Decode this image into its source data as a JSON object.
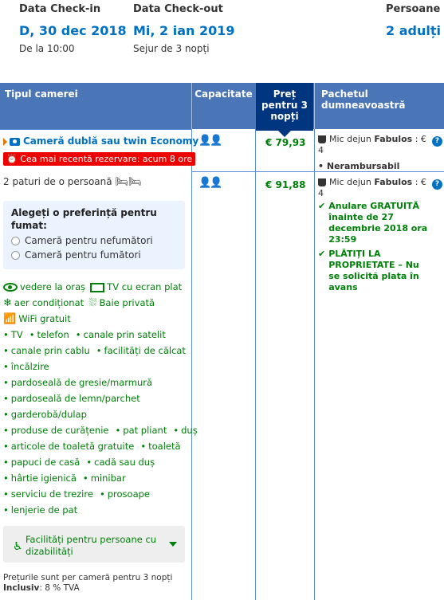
{
  "summary": {
    "checkin_label": "Data Check-in",
    "checkin_value": "D, 30 dec 2018",
    "checkin_sub": "De la 10:00",
    "checkout_label": "Data Check-out",
    "checkout_value": "Mi, 2 ian 2019",
    "checkout_sub": "Sejur de 3 nopți",
    "guests_label": "Persoane",
    "guests_value": "2 adulți"
  },
  "table_header": {
    "type": "Tipul camerei",
    "capacity": "Capacitate",
    "price": "Preț pentru 3 nopți",
    "package": "Pachetul dumneavoastră"
  },
  "room": {
    "title": "Cameră dublă sau twin Economy",
    "badge": "Cea mai recentă rezervare: acum 8 ore",
    "beds": "2 paturi de o persoană",
    "smoking_title": "Alegeți o preferință pentru fumat:",
    "smoking_options": [
      "Cameră pentru nefumători",
      "Cameră pentru fumători"
    ],
    "facilities_top": [
      "vedere la oraș",
      "TV cu ecran plat",
      "aer condiționat",
      "Baie privată",
      "WiFi gratuit"
    ],
    "facilities": [
      [
        "TV",
        "telefon",
        "canale prin satelit"
      ],
      [
        "canale prin cablu",
        "facilități de călcat"
      ],
      [
        "încălzire"
      ],
      [
        "pardoseală de gresie/marmură"
      ],
      [
        "pardoseală de lemn/parchet"
      ],
      [
        "garderobă/dulap"
      ],
      [
        "produse de curățenie",
        "pat pliant",
        "duș"
      ],
      [
        "articole de toaletă gratuite",
        "toaletă"
      ],
      [
        "papuci de casă",
        "cadă sau duș"
      ],
      [
        "hârtie igienică",
        "minibar"
      ],
      [
        "serviciu de trezire",
        "prosoape"
      ],
      [
        "lenjerie de pat"
      ]
    ],
    "accessibility": "Facilități pentru persoane cu dizabilități",
    "footnote_line1": "Prețurile sunt per cameră pentru 3 nopți",
    "footnote_bold": "Inclusiv",
    "footnote_rest": ": 8 % TVA"
  },
  "offers": [
    {
      "price": "€ 79,93",
      "meal_prefix": "Mic dejun ",
      "meal_bold": "Fabulos",
      "meal_price": " : € 4",
      "conditions": [
        "Nerambursabil"
      ]
    },
    {
      "price": "€ 91,88",
      "meal_prefix": "Mic dejun ",
      "meal_bold": "Fabulos",
      "meal_price": " : € 4",
      "green_conditions": [
        "Anulare GRATUITĂ înainte de 27 decembrie 2018 ora 23:59",
        "PLĂTIȚI LA PROPRIETATE – Nu se solicită plata în avans"
      ]
    }
  ],
  "colors": {
    "header_bg": "#4a75b6",
    "price_header_bg": "#003580",
    "link_blue": "#0071c2",
    "green": "#008009",
    "badge_red": "#e00000"
  }
}
